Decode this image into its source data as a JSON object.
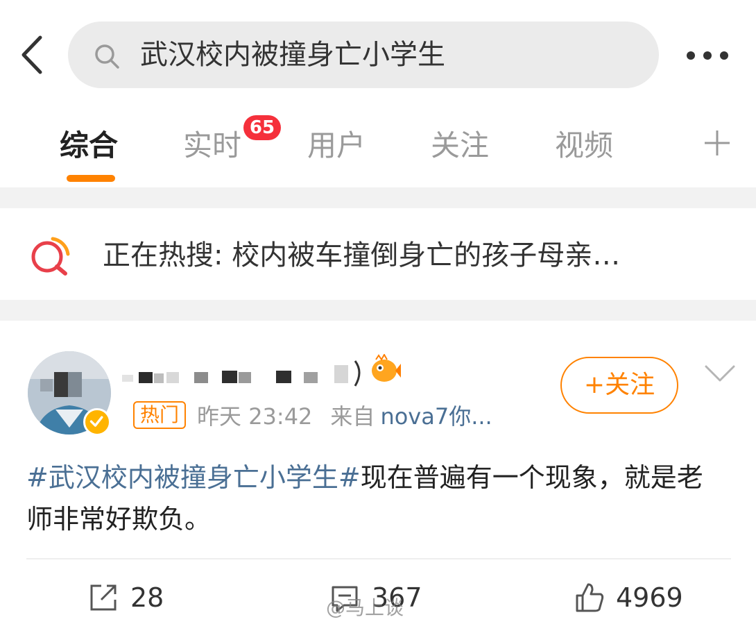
{
  "search": {
    "query": "武汉校内被撞身亡小学生"
  },
  "tabs": [
    {
      "label": "综合",
      "active": true
    },
    {
      "label": "实时",
      "badge": "65"
    },
    {
      "label": "用户"
    },
    {
      "label": "关注"
    },
    {
      "label": "视频"
    }
  ],
  "hot_search": {
    "text": "正在热搜: 校内被车撞倒身亡的孩子母亲…"
  },
  "post": {
    "tag": "热门",
    "time": "昨天 23:42",
    "source_label": "来自",
    "source": "nova7你...",
    "follow_label": "+关注",
    "hashtag": "#武汉校内被撞身亡小学生#",
    "body": "现在普遍有一个现象，就是老师非常好欺负。",
    "shares": "28",
    "comments": "367",
    "likes": "4969"
  },
  "watermark": "@马上谈",
  "colors": {
    "accent": "#ff8200",
    "badge": "#f5303b",
    "link": "#4a6f94",
    "separator": "#f2f2f2"
  },
  "icons": [
    "back-arrow-icon",
    "search-icon",
    "more-icon",
    "plus-icon",
    "hot-search-icon",
    "vip-icon",
    "verified-icon",
    "chevron-down-icon",
    "share-icon",
    "comment-icon",
    "like-icon"
  ]
}
